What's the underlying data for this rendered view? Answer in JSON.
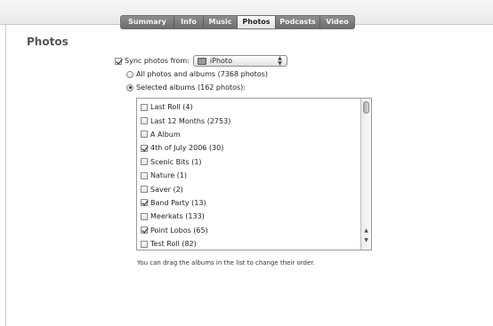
{
  "tabs": [
    {
      "label": "Summary",
      "selected": false
    },
    {
      "label": "Info",
      "selected": false
    },
    {
      "label": "Music",
      "selected": false
    },
    {
      "label": "Photos",
      "selected": true
    },
    {
      "label": "Podcasts",
      "selected": false
    },
    {
      "label": "Video",
      "selected": false
    }
  ],
  "page_title": "Photos",
  "sync": {
    "label": "Sync photos from:",
    "checked": true,
    "source_value": "iPhoto",
    "source_icon": "iphoto-icon"
  },
  "options": {
    "all_label": "All photos and albums (7368 photos)",
    "selected_label": "Selected albums (162 photos):",
    "selected_choice": "selected"
  },
  "albums": [
    {
      "label": "Last Roll (4)",
      "checked": false
    },
    {
      "label": "Last 12 Months (2753)",
      "checked": false
    },
    {
      "label": "A Album",
      "checked": false
    },
    {
      "label": "4th of July 2006 (30)",
      "checked": true
    },
    {
      "label": "Scenic Bits (1)",
      "checked": false
    },
    {
      "label": "Nature (1)",
      "checked": false
    },
    {
      "label": "Saver (2)",
      "checked": false
    },
    {
      "label": "Band Party (13)",
      "checked": true
    },
    {
      "label": "Meerkats (133)",
      "checked": false
    },
    {
      "label": "Point Lobos (65)",
      "checked": true
    },
    {
      "label": "Test Roll (82)",
      "checked": false
    }
  ],
  "hint": "You can drag the albums in the list to change their order."
}
